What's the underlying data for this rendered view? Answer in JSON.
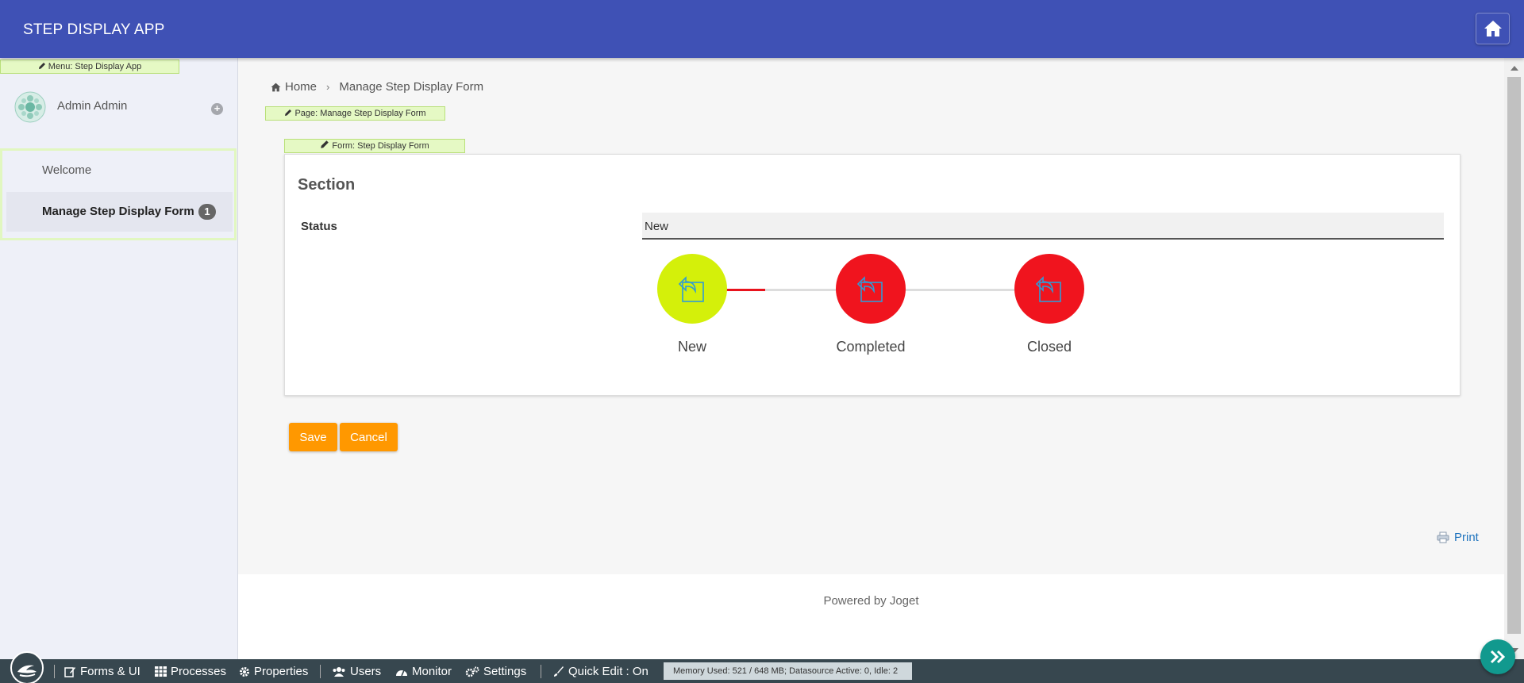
{
  "header": {
    "app_title": "STEP DISPLAY APP",
    "home_icon": "home-icon"
  },
  "sidebar": {
    "menu_quick_edit": "Menu: Step Display App",
    "profile_name": "Admin Admin",
    "menu_items": [
      {
        "label": "Welcome"
      },
      {
        "label": "Manage Step Display Form",
        "badge": "1"
      }
    ]
  },
  "breadcrumb": {
    "home": "Home",
    "current": "Manage Step Display Form"
  },
  "page_quick_edit": "Page: Manage Step Display Form",
  "form_quick_edit": "Form: Step Display Form",
  "form": {
    "section_title": "Section",
    "status_label": "Status",
    "status_value": "New",
    "steps": [
      {
        "label": "New",
        "color": "#d4f00a"
      },
      {
        "label": "Completed",
        "color": "#f0141e"
      },
      {
        "label": "Closed",
        "color": "#f0141e"
      }
    ],
    "progress_line_color": "#e8131d",
    "inactive_line_color": "#dddddd"
  },
  "buttons": {
    "save": "Save",
    "cancel": "Cancel"
  },
  "print_label": "Print",
  "footer": {
    "powered_by": "Powered by Joget"
  },
  "adminbar": {
    "items": [
      "Forms & UI",
      "Processes",
      "Properties",
      "Users",
      "Monitor",
      "Settings"
    ],
    "quick_edit": "Quick Edit : On",
    "memory": "Memory Used: 521 / 648 MB; Datasource Active: 0, Idle: 2"
  },
  "colors": {
    "header": "#3f51b5",
    "accent": "#ff9800",
    "adminbar": "#37474f"
  }
}
